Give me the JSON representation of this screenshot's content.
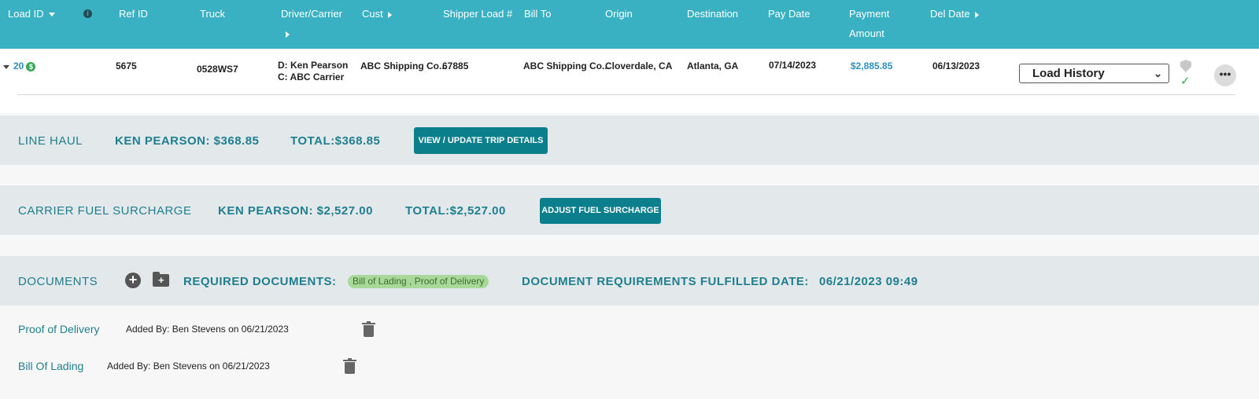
{
  "header": {
    "load_id": "Load ID",
    "ref_id": "Ref ID",
    "truck": "Truck",
    "driver_carrier": "Driver/Carrier",
    "cust": "Cust",
    "shipper_load": "Shipper Load #",
    "bill_to": "Bill To",
    "origin": "Origin",
    "destination": "Destination",
    "pay_date": "Pay Date",
    "payment_amount_line1": "Payment",
    "payment_amount_line2": "Amount",
    "del_date": "Del Date",
    "info_glyph": "i"
  },
  "row": {
    "load_id": "20",
    "dollar_glyph": "$",
    "ref_id": "5675",
    "truck": "0528WS7",
    "driver": "D: Ken Pearson",
    "carrier": "C: ABC Carrier",
    "cust": "ABC Shipping Co...",
    "shipper_load": "67885",
    "bill_to": "ABC Shipping Co...",
    "origin": "Cloverdale, CA",
    "destination": "Atlanta, GA",
    "pay_date": "07/14/2023",
    "payment_amount": "$2,885.85",
    "del_date": "06/13/2023",
    "select_value": "Load History",
    "more_glyph": "•••",
    "check_glyph": "✓",
    "chevron_glyph": "⌄"
  },
  "line_haul": {
    "title": "LINE HAUL",
    "driver_amount": "KEN PEARSON: $368.85",
    "total": "TOTAL:$368.85",
    "button": "VIEW / UPDATE TRIP DETAILS"
  },
  "fuel": {
    "title": "CARRIER FUEL SURCHARGE",
    "driver_amount": "KEN PEARSON: $2,527.00",
    "total": "TOTAL:$2,527.00",
    "button": "ADJUST FUEL SURCHARGE"
  },
  "documents": {
    "title": "DOCUMENTS",
    "add_glyph": "+",
    "folder_glyph": "+",
    "required_label": "REQUIRED DOCUMENTS:",
    "required_value": "Bill of Lading , Proof of Delivery",
    "fulfilled_label": "DOCUMENT REQUIREMENTS FULFILLED DATE:",
    "fulfilled_value": "06/21/2023 09:49",
    "items": [
      {
        "name": "Proof of Delivery",
        "meta": "Added By: Ben Stevens on 06/21/2023"
      },
      {
        "name": "Bill Of Lading",
        "meta": "Added By: Ben Stevens on 06/21/2023"
      }
    ]
  },
  "colors": {
    "header": "#3ab1c2",
    "accent": "#0b7f8c",
    "band": "#e3e8ea",
    "link": "#2a8fc2",
    "success": "#36a856"
  }
}
